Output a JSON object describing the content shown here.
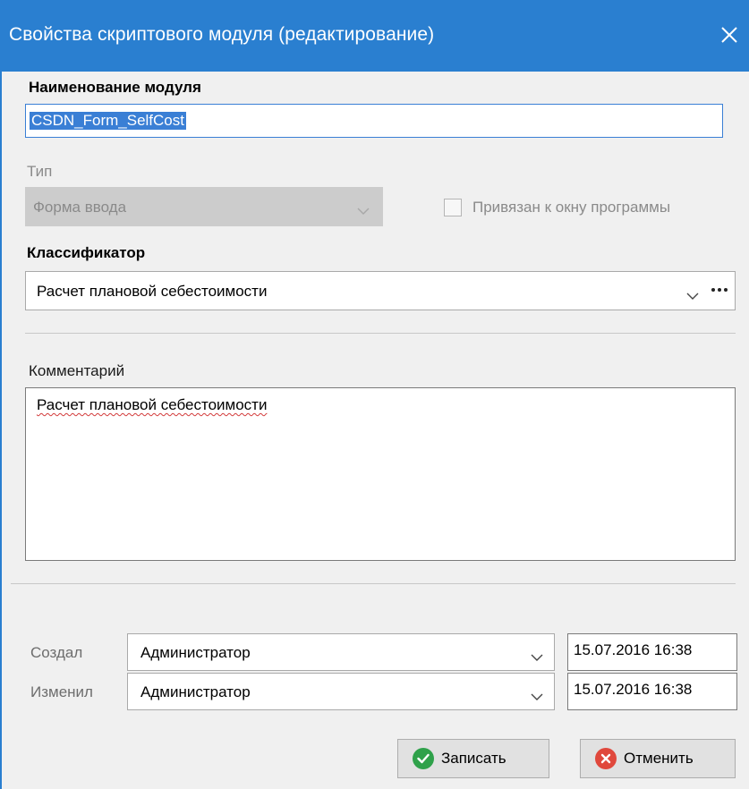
{
  "dialog": {
    "title": "Свойства скриптового модуля (редактирование)",
    "accent_color": "#2a7fd0"
  },
  "module_name": {
    "label": "Наименование модуля",
    "value": "CSDN_Form_SelfCost"
  },
  "type": {
    "label": "Тип",
    "value": "Форма ввода"
  },
  "bound_checkbox": {
    "label": "Привязан к окну программы",
    "checked": false
  },
  "classifier": {
    "label": "Классификатор",
    "value": "Расчет плановой себестоимости"
  },
  "comment": {
    "label": "Комментарий",
    "value": "Расчет плановой себестоимости"
  },
  "created": {
    "label": "Создал",
    "user": "Администратор",
    "date": "15.07.2016 16:38"
  },
  "modified": {
    "label": "Изменил",
    "user": "Администратор",
    "date": "15.07.2016 16:38"
  },
  "buttons": {
    "save": "Записать",
    "cancel": "Отменить",
    "save_icon_color": "#2fa14a",
    "cancel_icon_color": "#e0483c"
  }
}
